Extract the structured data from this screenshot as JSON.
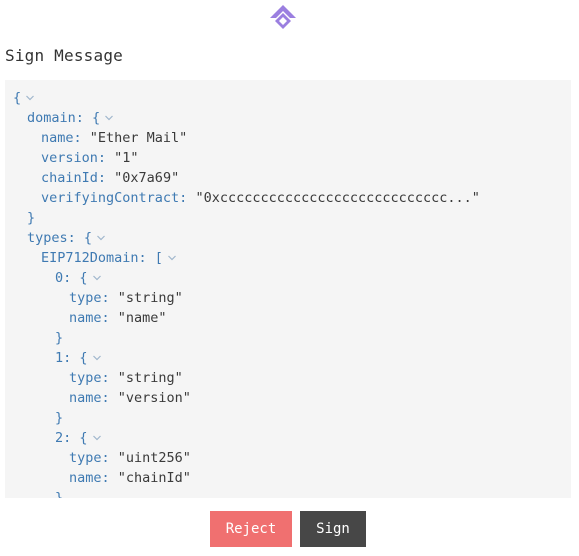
{
  "header": {
    "logo_icon": "diamond-arrow-logo-icon",
    "accent_color": "#9b7fe0"
  },
  "title": "Sign Message",
  "message": {
    "open_brace": "{",
    "domain_key": "domain: {",
    "domain_name": {
      "key": "name:",
      "value": "\"Ether Mail\""
    },
    "domain_version": {
      "key": "version:",
      "value": "\"1\""
    },
    "domain_chainId": {
      "key": "chainId:",
      "value": "\"0x7a69\""
    },
    "domain_verifyingContract": {
      "key": "verifyingContract:",
      "value": "\"0xcccccccccccccccccccccccccccc...\""
    },
    "domain_close": "}",
    "types_key": "types: {",
    "eip712domain_key": "EIP712Domain: [",
    "entry0_key": "0: {",
    "entry0_type": {
      "key": "type:",
      "value": "\"string\""
    },
    "entry0_name": {
      "key": "name:",
      "value": "\"name\""
    },
    "entry0_close": "}",
    "entry1_key": "1: {",
    "entry1_type": {
      "key": "type:",
      "value": "\"string\""
    },
    "entry1_name": {
      "key": "name:",
      "value": "\"version\""
    },
    "entry1_close": "}",
    "entry2_key": "2: {",
    "entry2_type": {
      "key": "type:",
      "value": "\"uint256\""
    },
    "entry2_name": {
      "key": "name:",
      "value": "\"chainId\""
    },
    "entry2_close": "}"
  },
  "buttons": {
    "reject_label": "Reject",
    "sign_label": "Sign",
    "reject_color": "#f07070",
    "sign_color": "#474747"
  },
  "icons": {
    "collapse": "chevron-down-icon"
  }
}
